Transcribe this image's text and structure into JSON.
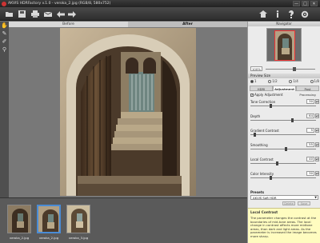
{
  "window": {
    "title": "AKVIS HDRFactory v.1.0 - veroka_2.jpg (RGB/8, 580x752)",
    "controls": [
      "—",
      "□",
      "✕"
    ]
  },
  "toolbar": {
    "left_icons": [
      "open-icon",
      "save-icon",
      "print-icon",
      "share-icon",
      "undo-icon",
      "redo-icon"
    ],
    "right_icons": [
      "home-icon",
      "info-icon",
      "help-icon",
      "settings-icon"
    ]
  },
  "left_tools": [
    "hand-icon",
    "eyedropper-icon",
    "brush-icon",
    "zoom-icon"
  ],
  "viewer": {
    "before_label": "Before",
    "after_label": "After"
  },
  "panel": {
    "navigator_title": "Navigator",
    "zoom_value": "100%",
    "preview_size_title": "Preview Size",
    "preview_sizes": [
      {
        "label": "1",
        "selected": true
      },
      {
        "label": "1/2",
        "selected": false
      },
      {
        "label": "1/4",
        "selected": false
      },
      {
        "label": "1/8",
        "selected": false
      }
    ],
    "tabs": [
      {
        "label": "HDRI",
        "active": false
      },
      {
        "label": "Adjustment",
        "active": true
      },
      {
        "label": "Post Processing",
        "active": false
      }
    ],
    "apply_adjustment": "Apply Adjustment",
    "params": [
      {
        "label": "Tone Correction",
        "value": "30",
        "fraction": 0.3
      },
      {
        "label": "Depth",
        "value": "64",
        "fraction": 0.64
      },
      {
        "label": "Gradient Contrast",
        "value": "5",
        "fraction": 0.05
      },
      {
        "label": "Smoothing",
        "value": "55",
        "fraction": 0.55
      },
      {
        "label": "Local Contrast",
        "value": "40",
        "fraction": 0.4
      },
      {
        "label": "Color Intensity",
        "value": "30",
        "fraction": 0.3
      }
    ],
    "presets_title": "Presets",
    "preset_value": "AKVIS Soft HDR",
    "preset_buttons": [
      "Delete",
      "Save"
    ],
    "info_title": "Local Contrast",
    "info_text": "The parameter changes the contrast at the boundaries of mid-tone areas. The local change in contrast affects more midtone areas, than dark and light areas. As the parameter is increased the image becomes more sharp."
  },
  "filmstrip": [
    {
      "label": "veroka_2.jpg",
      "selected": false
    },
    {
      "label": "veroka_2.jpg",
      "selected": true
    },
    {
      "label": "veroka_3.jpg",
      "selected": false
    }
  ],
  "colors": {
    "accent": "#4a8cd6",
    "info_bg": "#fffcc0"
  }
}
